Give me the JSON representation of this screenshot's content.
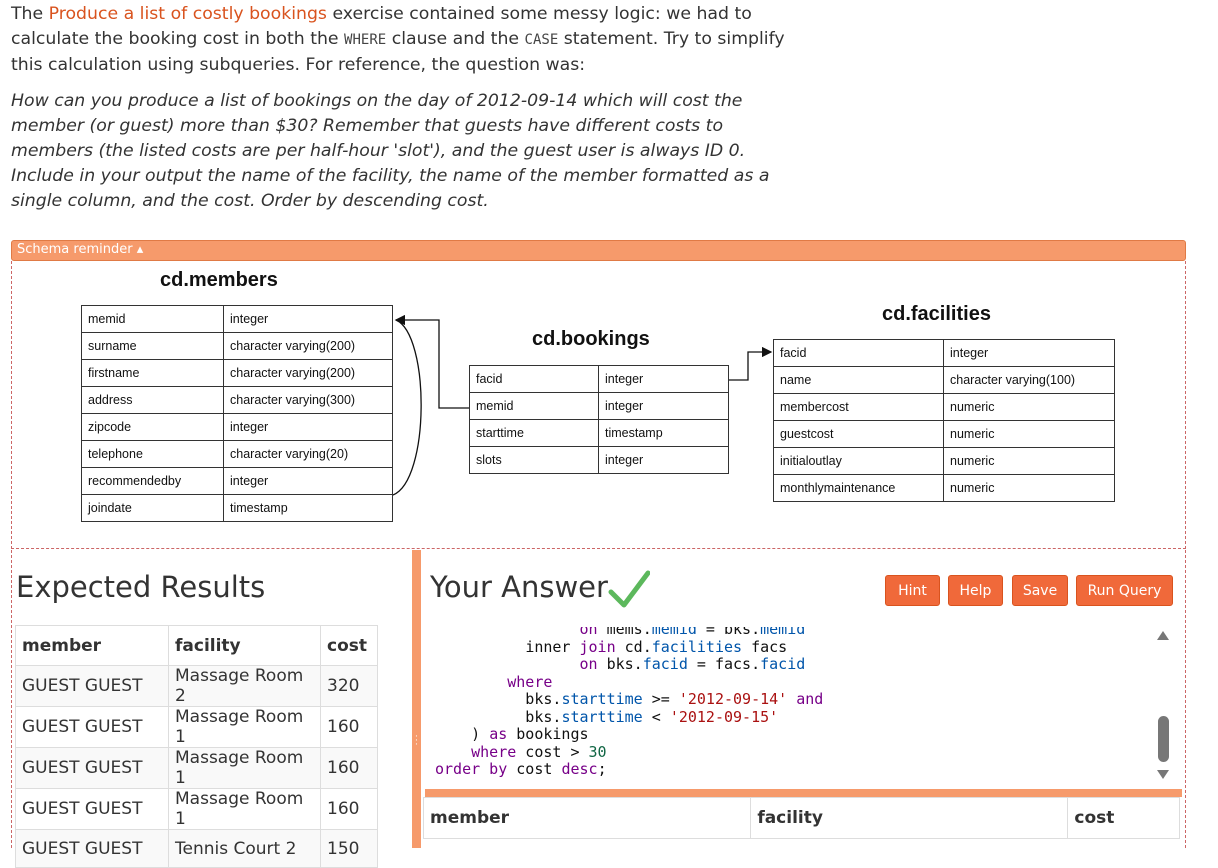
{
  "intro": {
    "text_1": "The ",
    "link": "Produce a list of costly bookings",
    "text_2": " exercise contained some messy logic: we had to calculate the booking cost in both the ",
    "code_where": "WHERE",
    "text_3": " clause and the ",
    "code_case": "CASE",
    "text_4": " statement. Try to simplify this calculation using subqueries. For reference, the question was:",
    "question": "How can you produce a list of bookings on the day of 2012-09-14 which will cost the member (or guest) more than $30? Remember that guests have different costs to members (the listed costs are per half-hour 'slot'), and the guest user is always ID 0. Include in your output the name of the facility, the name of the member formatted as a single column, and the cost. Order by descending cost."
  },
  "schema": {
    "toggle_label": "Schema reminder ▴",
    "members": {
      "title": "cd.members",
      "rows": [
        [
          "memid",
          "integer"
        ],
        [
          "surname",
          "character varying(200)"
        ],
        [
          "firstname",
          "character varying(200)"
        ],
        [
          "address",
          "character varying(300)"
        ],
        [
          "zipcode",
          "integer"
        ],
        [
          "telephone",
          "character varying(20)"
        ],
        [
          "recommendedby",
          "integer"
        ],
        [
          "joindate",
          "timestamp"
        ]
      ]
    },
    "bookings": {
      "title": "cd.bookings",
      "rows": [
        [
          "facid",
          "integer"
        ],
        [
          "memid",
          "integer"
        ],
        [
          "starttime",
          "timestamp"
        ],
        [
          "slots",
          "integer"
        ]
      ]
    },
    "facilities": {
      "title": "cd.facilities",
      "rows": [
        [
          "facid",
          "integer"
        ],
        [
          "name",
          "character varying(100)"
        ],
        [
          "membercost",
          "numeric"
        ],
        [
          "guestcost",
          "numeric"
        ],
        [
          "initialoutlay",
          "numeric"
        ],
        [
          "monthlymaintenance",
          "numeric"
        ]
      ]
    }
  },
  "expected": {
    "heading": "Expected Results",
    "columns": [
      "member",
      "facility",
      "cost"
    ],
    "rows": [
      [
        "GUEST GUEST",
        "Massage Room 2",
        "320"
      ],
      [
        "GUEST GUEST",
        "Massage Room 1",
        "160"
      ],
      [
        "GUEST GUEST",
        "Massage Room 1",
        "160"
      ],
      [
        "GUEST GUEST",
        "Massage Room 1",
        "160"
      ],
      [
        "GUEST GUEST",
        "Tennis Court 2",
        "150"
      ]
    ]
  },
  "answer": {
    "heading": "Your Answer",
    "check_icon": "checkmark-icon",
    "buttons": {
      "hint": "Hint",
      "help": "Help",
      "save": "Save",
      "run": "Run Query"
    },
    "columns": [
      "member",
      "facility",
      "cost"
    ]
  },
  "colors": {
    "accent": "#f0693a",
    "bar": "#f69a6b",
    "link": "#d9531e",
    "check": "#5cb85c"
  }
}
